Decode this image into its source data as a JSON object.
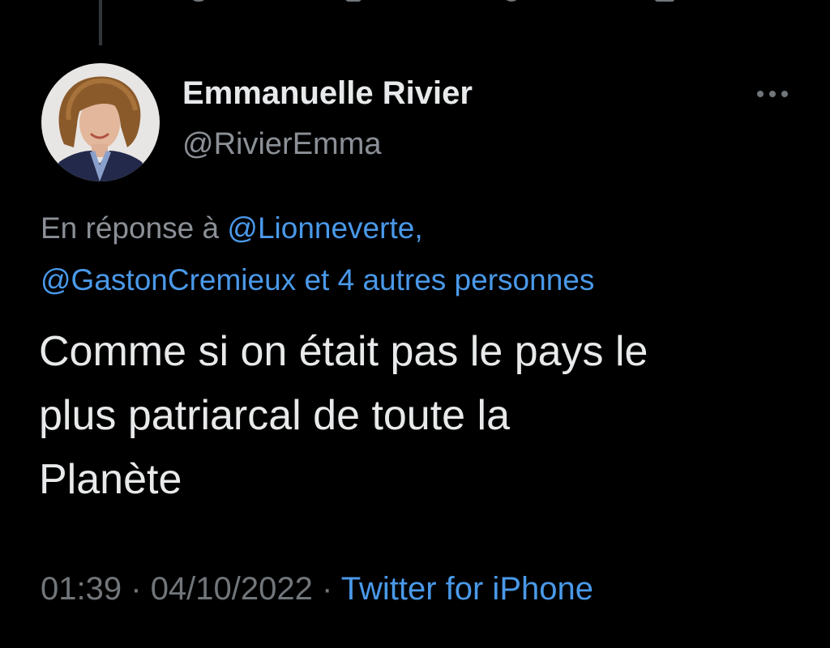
{
  "tweet": {
    "author": {
      "display_name": "Emmanuelle Rivier",
      "handle": "@RivierEmma"
    },
    "reply_context": {
      "prefix": "En réponse à",
      "mentions": [
        "@Lionneverte,",
        "@GastonCremieux"
      ],
      "suffix": "et 4 autres personnes"
    },
    "text_lines": [
      "Comme si on était pas le pays le",
      "plus patriarcal de toute la",
      "Planète"
    ],
    "time": "01:39",
    "separator": "·",
    "date": "04/10/2022",
    "source": "Twitter for iPhone"
  },
  "icons": {
    "more": "more-horizontal-icon",
    "top_actions": [
      "reply-icon",
      "retweet-icon",
      "like-icon",
      "share-icon"
    ]
  },
  "colors": {
    "background": "#000000",
    "primary_text": "#e7e9ea",
    "secondary_text": "#8b9097",
    "link": "#4a99e9",
    "thread_line": "#333639"
  }
}
